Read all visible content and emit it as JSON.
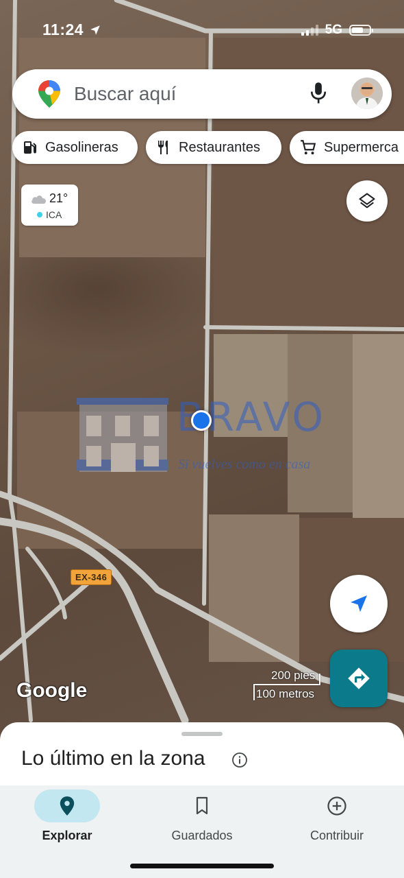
{
  "status_bar": {
    "time": "11:24",
    "network": "5G"
  },
  "search": {
    "placeholder": "Buscar aquí"
  },
  "chips": [
    {
      "label": "Gasolineras",
      "icon": "gas-station-icon"
    },
    {
      "label": "Restaurantes",
      "icon": "restaurant-icon"
    },
    {
      "label": "Supermerca",
      "icon": "shopping-cart-icon"
    }
  ],
  "weather": {
    "temperature": "21°",
    "aqi_label": "ICA",
    "icon": "cloud-icon"
  },
  "map": {
    "road_label": "EX-346",
    "attribution": "Google",
    "scale_imperial": "200 pies",
    "scale_metric": "100 metros",
    "watermark": {
      "name": "BRAVO",
      "tagline": "Si vuelves como en casa"
    }
  },
  "bottom_sheet": {
    "title": "Lo último en la zona"
  },
  "nav": [
    {
      "label": "Explorar",
      "icon": "location-pin-icon",
      "active": true
    },
    {
      "label": "Guardados",
      "icon": "bookmark-icon",
      "active": false
    },
    {
      "label": "Contribuir",
      "icon": "add-circle-icon",
      "active": false
    }
  ],
  "colors": {
    "accent": "#1a73e8",
    "directions_button": "#0b7a8a",
    "nav_active_pill": "#c2e7f0"
  }
}
